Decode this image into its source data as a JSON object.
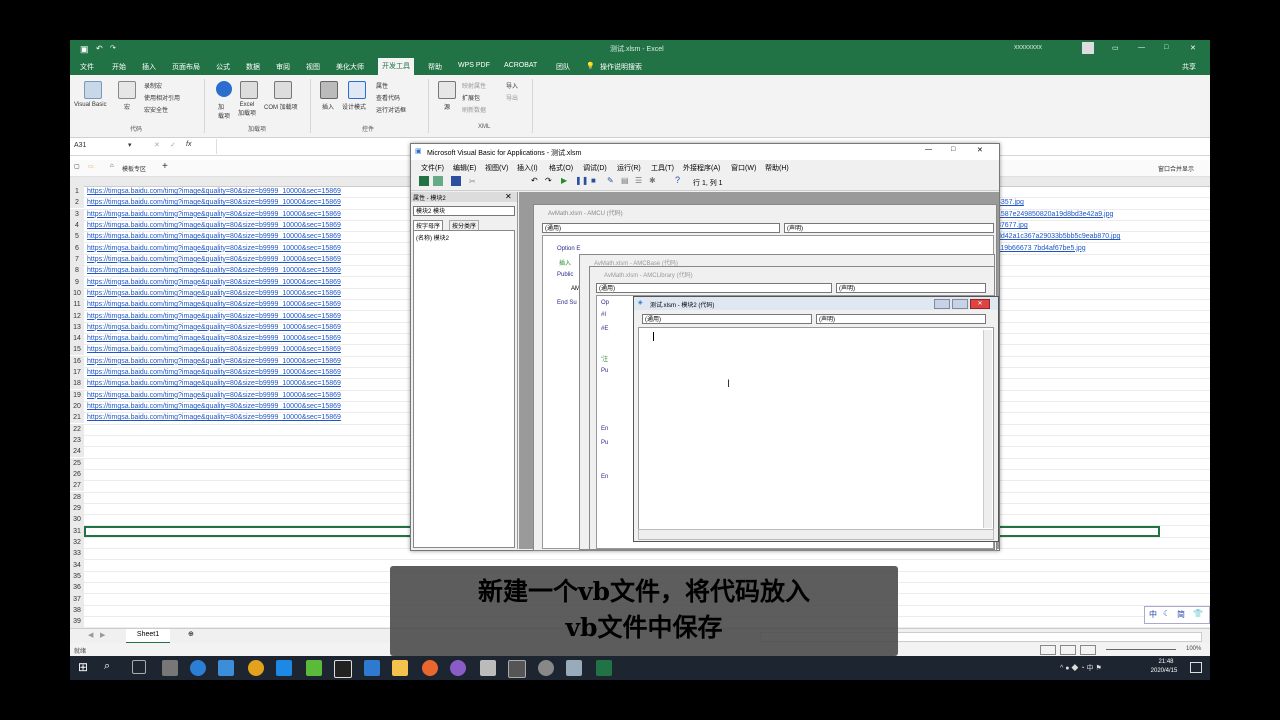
{
  "excel": {
    "window_title": "测试.xlsm - Excel",
    "account": "xxxxxxxx",
    "tabs": [
      "文件",
      "开始",
      "插入",
      "页面布局",
      "公式",
      "数据",
      "审阅",
      "视图",
      "美化大师",
      "开发工具",
      "帮助",
      "WPS PDF",
      "ACROBAT",
      "团队"
    ],
    "active_tab": "开发工具",
    "tell_me": "操作说明搜索",
    "share": "共享",
    "ribbon": {
      "visual_basic": "Visual Basic",
      "macro": "宏",
      "record_macro": "录制宏",
      "relative_ref": "使用相对引用",
      "macro_security": "宏安全性",
      "group_code": "代码",
      "addins": "加\n载项",
      "excel_addins": "Excel\n加载项",
      "com_addins": "COM 加载项",
      "group_addins": "加载项",
      "insert": "插入",
      "design_mode": "设计模式",
      "properties": "属性",
      "view_code": "查看代码",
      "run_dialog": "运行对话框",
      "group_controls": "控件",
      "source": "源",
      "map_props": "映射属性",
      "expansion_pack": "扩展包",
      "refresh_data": "刷新数据",
      "import": "导入",
      "export": "导出",
      "group_xml": "XML"
    },
    "name_box": "A31",
    "sheet_tab": "模板专区",
    "window_menu": "窗口合并显示",
    "sheet_name": "Sheet1",
    "status_ready": "就绪",
    "zoom": "100%",
    "row_numbers": [
      "1",
      "2",
      "3",
      "4",
      "5",
      "6",
      "7",
      "8",
      "9",
      "10",
      "11",
      "12",
      "13",
      "14",
      "15",
      "16",
      "17",
      "18",
      "19",
      "20",
      "21",
      "22",
      "23",
      "24",
      "25",
      "26",
      "27",
      "28",
      "29",
      "30",
      "31",
      "32",
      "33",
      "34",
      "35",
      "36",
      "37",
      "38",
      "39"
    ],
    "link_prefix": "https://timgsa.baidu.com/timg?image&quality=80&size=b9999_10000&sec=15869",
    "right_links": [
      "4357.jpg",
      "1587e249850820a19d8bd3e42a9.jpg",
      "37677.jpg",
      "dd42a1c367a29033b5bb5c9eab870.jpg",
      "119b66673 7bd4af67be5.jpg"
    ]
  },
  "vba": {
    "title": "Microsoft Visual Basic for Applications - 测试.xlsm",
    "menu": [
      "文件(F)",
      "编辑(E)",
      "视图(V)",
      "插入(I)",
      "格式(O)",
      "调试(D)",
      "运行(R)",
      "工具(T)",
      "外接程序(A)",
      "窗口(W)",
      "帮助(H)"
    ],
    "position": "行 1, 列 1",
    "props_title": "属性 - 模块2",
    "props_combo": "模块2 模块",
    "props_tab1": "按字母序",
    "props_tab2": "按分类序",
    "props_row": "(名称)  模块2",
    "win1_title": "AvMath.xlsm - AMCU (代码)",
    "win2_title": "AvMath.xlsm - AMCBase (代码)",
    "win3_title": "AvMath.xlsm - AMCLibrary (代码)",
    "win4_title": "测试.xlsm - 模块2 (代码)",
    "general": "(通用)",
    "declarations": "(声明)",
    "code_snips": [
      "Option E",
      "插入",
      "Public",
      "AM",
      "End Su"
    ],
    "code_snips2": [
      "Op",
      "#I",
      "#E",
      "'注",
      "Pu",
      "En",
      "Pu",
      "En"
    ]
  },
  "taskbar": {
    "time": "21:48",
    "date": "2020/4/15",
    "ime": "中",
    "ime2": "简"
  },
  "caption": {
    "line1": "新建一个vb文件，将代码放入",
    "line2": "vb文件中保存"
  }
}
